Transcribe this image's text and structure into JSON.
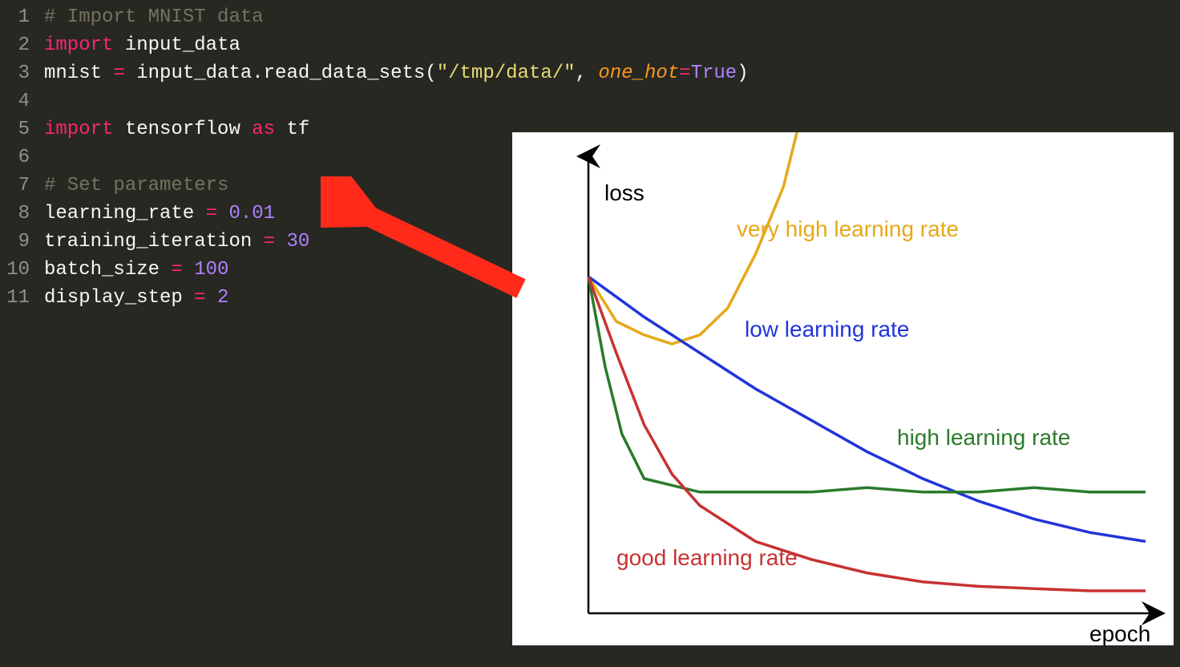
{
  "gutter": [
    "1",
    "2",
    "3",
    "4",
    "5",
    "6",
    "7",
    "8",
    "9",
    "10",
    "11"
  ],
  "code": {
    "line1_comment": "# Import MNIST data",
    "line2_import": "import",
    "line2_module": " input_data",
    "line3_pre": "mnist ",
    "line3_eq": "=",
    "line3_call": " input_data.read_data_sets(",
    "line3_str": "\"/tmp/data/\"",
    "line3_comma": ", ",
    "line3_arg": "one_hot",
    "line3_eq2": "=",
    "line3_true": "True",
    "line3_close": ")",
    "line5_import": "import",
    "line5_mod": " tensorflow ",
    "line5_as": "as",
    "line5_alias": " tf",
    "line7_comment": "# Set parameters",
    "line8_var": "learning_rate ",
    "line8_eq": "=",
    "line8_val": " 0.01",
    "line9_var": "training_iteration ",
    "line9_eq": "=",
    "line9_val": " 30",
    "line10_var": "batch_size ",
    "line10_eq": "=",
    "line10_val": " 100",
    "line11_var": "display_step ",
    "line11_eq": "=",
    "line11_val": " 2"
  },
  "chart": {
    "ylabel": "loss",
    "xlabel": "epoch",
    "labels": {
      "very_high": "very high learning rate",
      "low": "low learning rate",
      "high": "high learning rate",
      "good": "good learning rate"
    },
    "colors": {
      "very_high": "#e6a817",
      "low": "#2135d9",
      "high": "#2b7a2b",
      "good": "#c73232"
    }
  },
  "chart_data": {
    "type": "line",
    "title": "",
    "xlabel": "epoch",
    "ylabel": "loss",
    "xlim": [
      0,
      100
    ],
    "ylim": [
      0,
      100
    ],
    "series": [
      {
        "name": "very high learning rate",
        "color": "#e6a817",
        "x": [
          0,
          5,
          10,
          15,
          20,
          25,
          30,
          35,
          38
        ],
        "values": [
          75,
          65,
          62,
          60,
          62,
          68,
          80,
          95,
          110
        ]
      },
      {
        "name": "low learning rate",
        "color": "#2135d9",
        "x": [
          0,
          10,
          20,
          30,
          40,
          50,
          60,
          70,
          80,
          90,
          100
        ],
        "values": [
          75,
          66,
          58,
          50,
          43,
          36,
          30,
          25,
          21,
          18,
          16
        ]
      },
      {
        "name": "high learning rate",
        "color": "#2b7a2b",
        "x": [
          0,
          3,
          6,
          10,
          20,
          30,
          40,
          50,
          60,
          70,
          80,
          90,
          100
        ],
        "values": [
          75,
          55,
          40,
          30,
          27,
          27,
          27,
          28,
          27,
          27,
          28,
          27,
          27
        ]
      },
      {
        "name": "good learning rate",
        "color": "#c73232",
        "x": [
          0,
          5,
          10,
          15,
          20,
          30,
          40,
          50,
          60,
          70,
          80,
          90,
          100
        ],
        "values": [
          75,
          58,
          42,
          31,
          24,
          16,
          12,
          9,
          7,
          6,
          5.5,
          5,
          5
        ]
      }
    ]
  }
}
